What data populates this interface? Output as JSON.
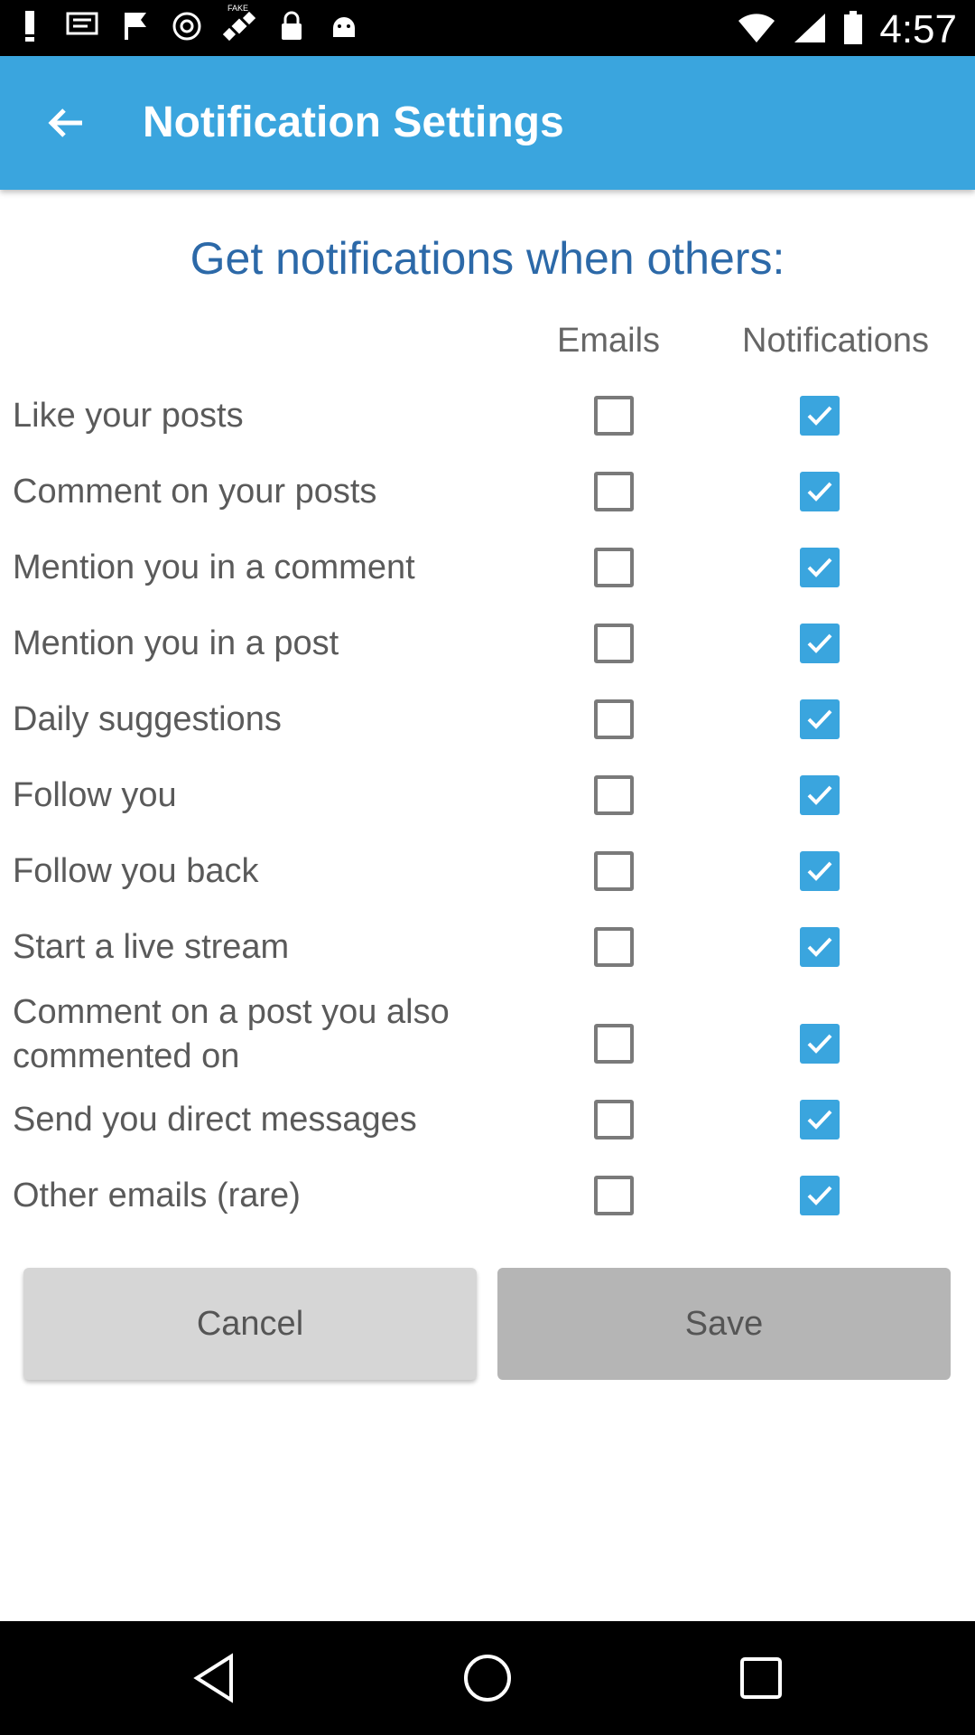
{
  "status_bar": {
    "time": "4:57",
    "left_icons": [
      "notification-icon",
      "message-icon",
      "flag-icon",
      "hotspot-icon",
      "satellite-icon",
      "lock-icon",
      "android-icon"
    ],
    "fake_label": "FAKE"
  },
  "app_bar": {
    "title": "Notification Settings",
    "color": "#3aa5de"
  },
  "heading": "Get notifications when others:",
  "columns": {
    "emails": "Emails",
    "notifications": "Notifications"
  },
  "rows": [
    {
      "label": "Like your posts",
      "email": false,
      "notification": true
    },
    {
      "label": "Comment on your posts",
      "email": false,
      "notification": true
    },
    {
      "label": "Mention you in a comment",
      "email": false,
      "notification": true
    },
    {
      "label": "Mention you in a post",
      "email": false,
      "notification": true
    },
    {
      "label": "Daily suggestions",
      "email": false,
      "notification": true
    },
    {
      "label": "Follow you",
      "email": false,
      "notification": true
    },
    {
      "label": "Follow you back",
      "email": false,
      "notification": true
    },
    {
      "label": "Start a live stream",
      "email": false,
      "notification": true
    },
    {
      "label": "Comment on a post you also commented on",
      "email": false,
      "notification": true
    },
    {
      "label": "Send you direct messages",
      "email": false,
      "notification": true
    },
    {
      "label": "Other emails (rare)",
      "email": false,
      "notification": true
    }
  ],
  "buttons": {
    "cancel": "Cancel",
    "save": "Save"
  },
  "nav": [
    "back-triangle-icon",
    "home-circle-icon",
    "recents-square-icon"
  ]
}
